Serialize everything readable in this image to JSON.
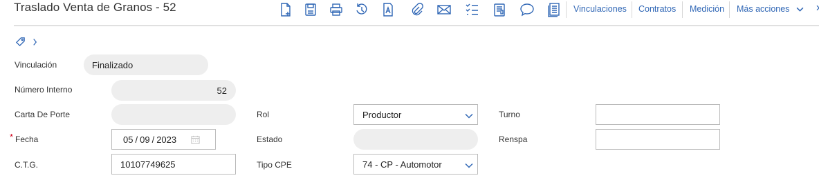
{
  "header": {
    "title": "Traslado Venta de Granos - 52"
  },
  "toolbar": {
    "icons": [
      "new-document-icon",
      "save-icon",
      "print-icon",
      "history-icon",
      "text-document-icon",
      "attach-icon",
      "mail-icon",
      "checklist-icon",
      "report-icon",
      "comment-icon",
      "notes-icon"
    ],
    "links": {
      "vinculaciones": "Vinculaciones",
      "contratos": "Contratos",
      "medicion": "Medición",
      "mas_acciones": "Más acciones",
      "close": "✕"
    }
  },
  "form": {
    "vinculacion": {
      "label": "Vinculación",
      "value": "Finalizado"
    },
    "numero_interno": {
      "label": "Número Interno",
      "value": "52"
    },
    "carta_de_porte": {
      "label": "Carta De Porte",
      "value": ""
    },
    "fecha": {
      "label": "Fecha",
      "required_mark": "*",
      "day": "05",
      "month": "09",
      "year": "2023",
      "sep": "/"
    },
    "ctg": {
      "label": "C.T.G.",
      "value": "10107749625"
    },
    "rol": {
      "label": "Rol",
      "value": "Productor"
    },
    "estado": {
      "label": "Estado",
      "value": ""
    },
    "tipo_cpe": {
      "label": "Tipo CPE",
      "value": "74 - CP - Automotor"
    },
    "turno": {
      "label": "Turno",
      "value": ""
    },
    "renspa": {
      "label": "Renspa",
      "value": ""
    }
  }
}
